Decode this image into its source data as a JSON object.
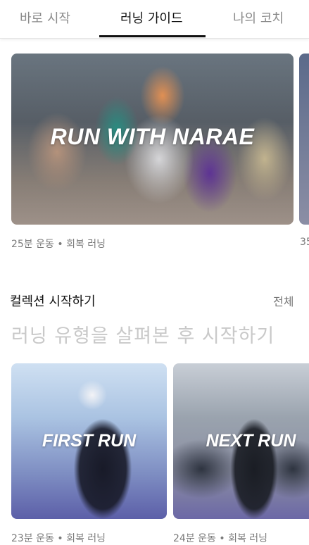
{
  "tabs": [
    {
      "label": "바로 시작",
      "active": false
    },
    {
      "label": "러닝 가이드",
      "active": true
    },
    {
      "label": "나의 코치",
      "active": false
    }
  ],
  "featured": {
    "title": "RUN WITH NARAE",
    "meta": "25분 운동 • 회복 러닝",
    "next_meta_peek": "35"
  },
  "collections": {
    "title": "컬렉션 시작하기",
    "all_label": "전체",
    "subtitle": "러닝 유형을 살펴본 후 시작하기",
    "cards": [
      {
        "title": "FIRST RUN",
        "meta": "23분 운동 • 회복 러닝"
      },
      {
        "title": "NEXT RUN",
        "meta": "24분 운동 • 회복 러닝"
      }
    ]
  },
  "colors": {
    "active_tab": "#111111",
    "inactive_tab": "#8a8a8a",
    "subtitle": "#c9c9c9",
    "meta": "#7a7a7a"
  }
}
